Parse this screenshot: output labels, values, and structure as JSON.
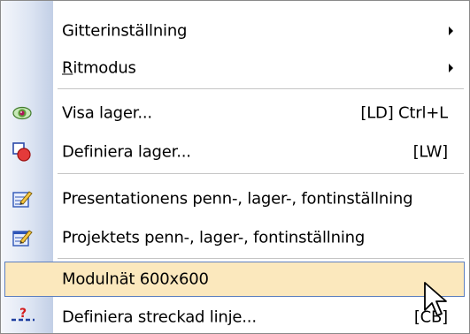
{
  "menu": {
    "items": [
      {
        "label": "Gitterinställning",
        "has_submenu": true
      },
      {
        "label": "Ritmodus",
        "has_submenu": true
      },
      {
        "label": "Visa lager...",
        "shortcut": "[LD] Ctrl+L",
        "icon": "eye-icon"
      },
      {
        "label": "Definiera lager...",
        "shortcut": "[LW]",
        "icon": "layer-shapes-icon"
      },
      {
        "label": "Presentationens penn-, lager-, fontinställning",
        "icon": "pen-notepad-icon"
      },
      {
        "label": "Projektets penn-, lager-, fontinställning",
        "icon": "pen-notepad-icon"
      },
      {
        "label": "Modulnät 600x600",
        "highlighted": true
      },
      {
        "label": "Definiera streckad linje...",
        "shortcut": "[CB]",
        "icon": "dashed-line-icon"
      }
    ]
  },
  "colors": {
    "highlight_fill": "#fbe8bd",
    "highlight_border": "#5d7fbf",
    "gutter": "#dde5f3"
  }
}
